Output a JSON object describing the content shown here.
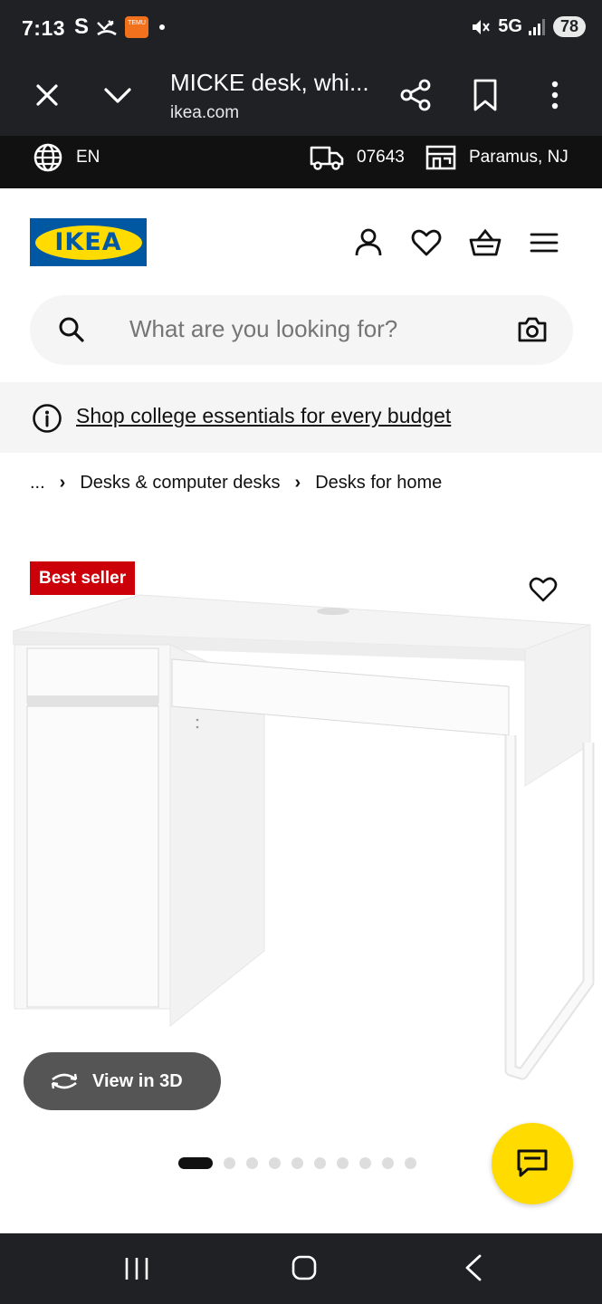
{
  "status_bar": {
    "time": "7:13",
    "app_icon_letter": "S",
    "temu_label": "TEMU",
    "network": "5G",
    "battery": "78"
  },
  "browser": {
    "page_title": "MICKE desk, whi...",
    "url": "ikea.com",
    "icons": [
      "close-icon",
      "chevron-down-icon",
      "share-icon",
      "bookmark-icon",
      "more-icon"
    ]
  },
  "store_bar": {
    "language": "EN",
    "zip_code": "07643",
    "store": "Paramus, NJ"
  },
  "header": {
    "logo_text": "IKEA",
    "icons": [
      "account-icon",
      "heart-icon",
      "cart-icon",
      "menu-icon"
    ]
  },
  "search": {
    "placeholder": "What are you looking for?"
  },
  "banner": {
    "link_text": "Shop college essentials for every budget"
  },
  "breadcrumb": {
    "items": [
      "...",
      "Desks & computer desks",
      "Desks for home"
    ]
  },
  "product": {
    "badge": "Best seller",
    "view_3d_label": "View in 3D",
    "carousel_count": 10,
    "carousel_active": 1
  },
  "colors": {
    "ikea_blue": "#0058a3",
    "ikea_yellow": "#ffdb00",
    "badge_red": "#cc0008",
    "dark_chrome": "#1f2125"
  }
}
